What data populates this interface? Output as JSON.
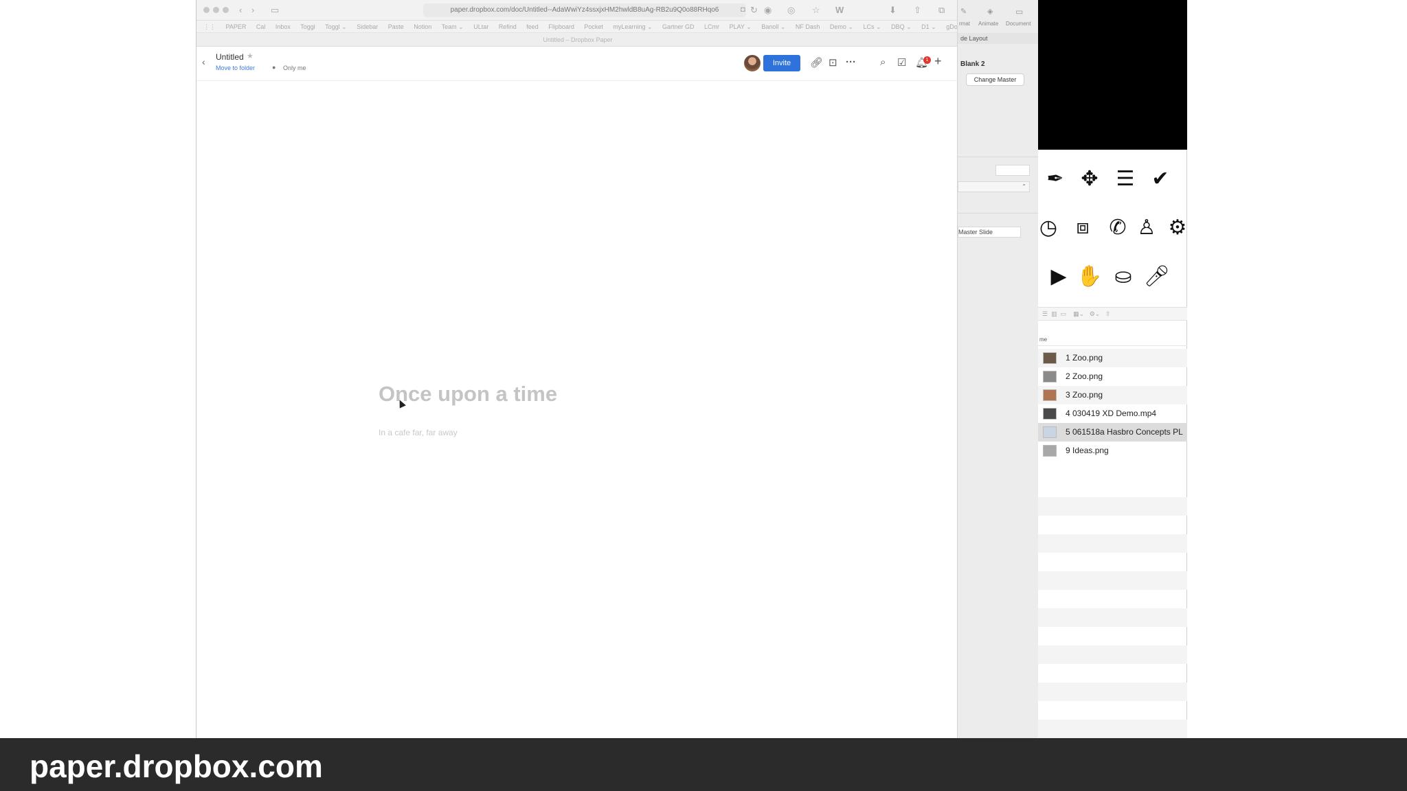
{
  "browser": {
    "url": "paper.dropbox.com/doc/Untitled--AdaWwiYz4ssxjxHM2hwldB8uAg-RB2u9Q0o88RHqo6",
    "tab_title": "Untitled – Dropbox Paper",
    "bookmarks": [
      "PAPER",
      "Cal",
      "Inbox",
      "Toggl",
      "Toggl ⌄",
      "Sidebar",
      "Paste",
      "Notion",
      "Team ⌄",
      "ULtar",
      "Refind",
      "feed",
      "Flipboard",
      "Pocket",
      "myLearning ⌄",
      "Gartner GD",
      "LCmr",
      "PLAY ⌄",
      "Banoll ⌄",
      "NF Dash",
      "Demo ⌄",
      "LCs ⌄",
      "DBQ ⌄",
      "D1 ⌄",
      "gDocs"
    ],
    "reader_icon": "W"
  },
  "paper": {
    "doc_title": "Untitled",
    "move_to_folder": "Move to folder",
    "sharing": "Only me",
    "invite_label": "Invite",
    "notification_count": "1"
  },
  "document": {
    "heading_placeholder": "Once upon a time",
    "body_placeholder": "In a cafe far, far away"
  },
  "inspector": {
    "tabs": [
      "rmat",
      "Animate",
      "Document"
    ],
    "section": "de Layout",
    "master_name": "Blank 2",
    "change_master_label": "Change Master",
    "master_slide_label": "Master Slide"
  },
  "files": {
    "column_header": "me",
    "items": [
      {
        "name": "1 Zoo.png",
        "thumb": "#6b5a48"
      },
      {
        "name": "2 Zoo.png",
        "thumb": "#8a8a8a"
      },
      {
        "name": "3 Zoo.png",
        "thumb": "#b07550"
      },
      {
        "name": "4 030419 XD Demo.mp4",
        "thumb": "#4a4a4a"
      },
      {
        "name": "5 061518a Hasbro Concepts PL",
        "thumb": "#c9d4e4"
      },
      {
        "name": "9 Ideas.png",
        "thumb": "#a8a8a8"
      }
    ]
  },
  "caption": "paper.dropbox.com"
}
